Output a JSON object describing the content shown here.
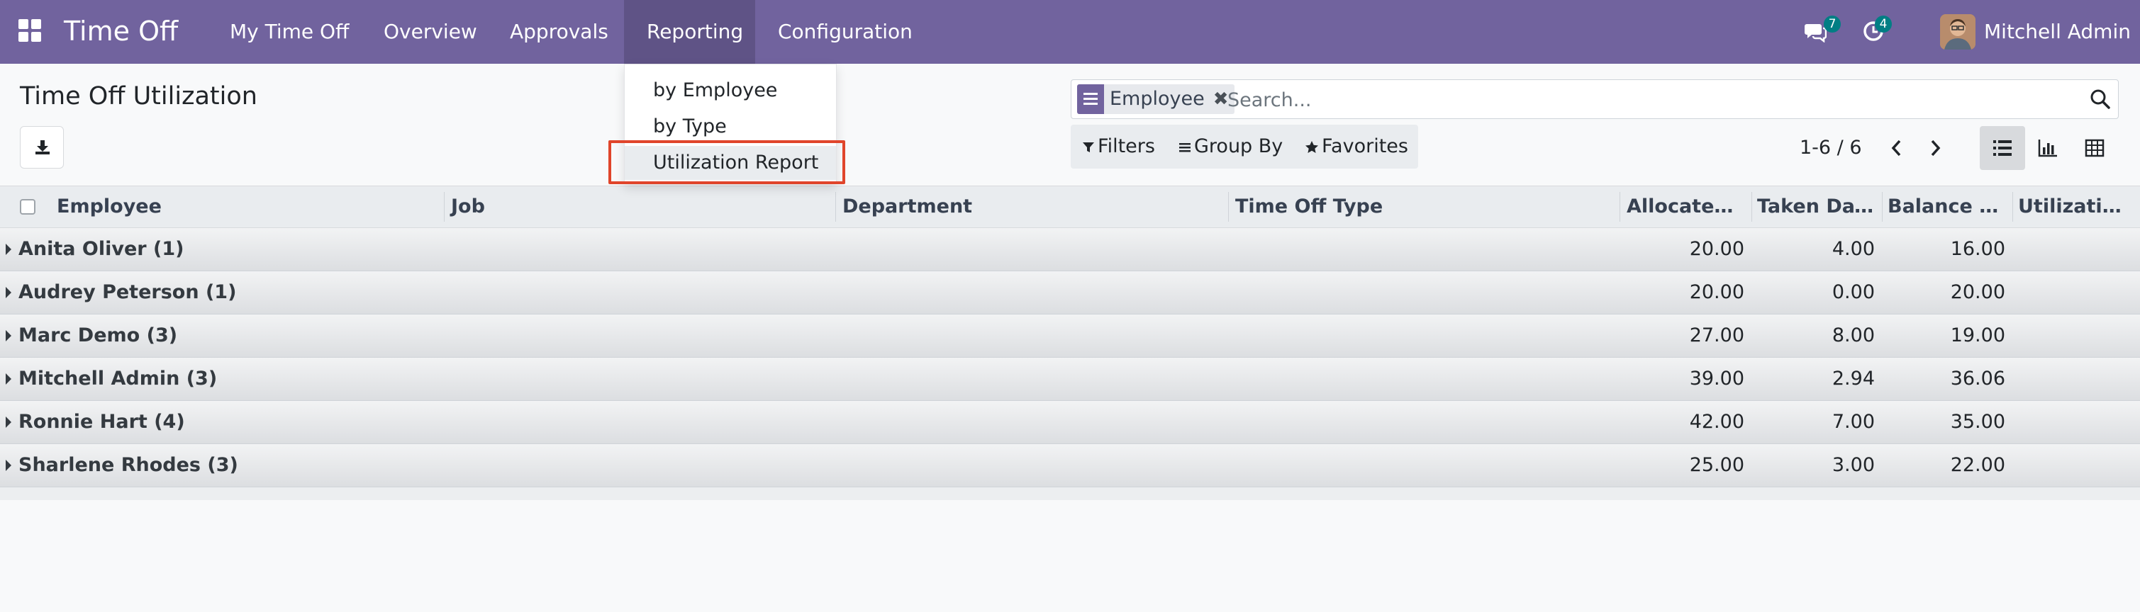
{
  "navbar": {
    "app_title": "Time Off",
    "menu": [
      "My Time Off",
      "Overview",
      "Approvals",
      "Reporting",
      "Configuration"
    ],
    "active_menu": "Reporting",
    "messages_badge": "7",
    "activities_badge": "4",
    "user_name": "Mitchell Admin",
    "colors": {
      "navbar": "#71639e",
      "badge": "#017e84"
    }
  },
  "reporting_menu": {
    "items": [
      "by Employee",
      "by Type",
      "Utilization Report"
    ],
    "active_item": "Utilization Report",
    "highlight_color": "#e0452b"
  },
  "control_panel": {
    "title": "Time Off Utilization",
    "facet_label": "Employee",
    "search_placeholder": "Search...",
    "filters_label": "Filters",
    "group_by_label": "Group By",
    "favorites_label": "Favorites",
    "pager_text": "1-6 / 6",
    "active_view": "list"
  },
  "table": {
    "columns": [
      "Employee",
      "Job",
      "Department",
      "Time Off Type",
      "Allocated ...",
      "Taken Day...",
      "Balance D...",
      "Utilization..."
    ],
    "groups": [
      {
        "name": "Anita Oliver (1)",
        "allocated": "20.00",
        "taken": "4.00",
        "balance": "16.00"
      },
      {
        "name": "Audrey Peterson (1)",
        "allocated": "20.00",
        "taken": "0.00",
        "balance": "20.00"
      },
      {
        "name": "Marc Demo (3)",
        "allocated": "27.00",
        "taken": "8.00",
        "balance": "19.00"
      },
      {
        "name": "Mitchell Admin (3)",
        "allocated": "39.00",
        "taken": "2.94",
        "balance": "36.06"
      },
      {
        "name": "Ronnie Hart (4)",
        "allocated": "42.00",
        "taken": "7.00",
        "balance": "35.00"
      },
      {
        "name": "Sharlene Rhodes (3)",
        "allocated": "25.00",
        "taken": "3.00",
        "balance": "22.00"
      }
    ]
  }
}
